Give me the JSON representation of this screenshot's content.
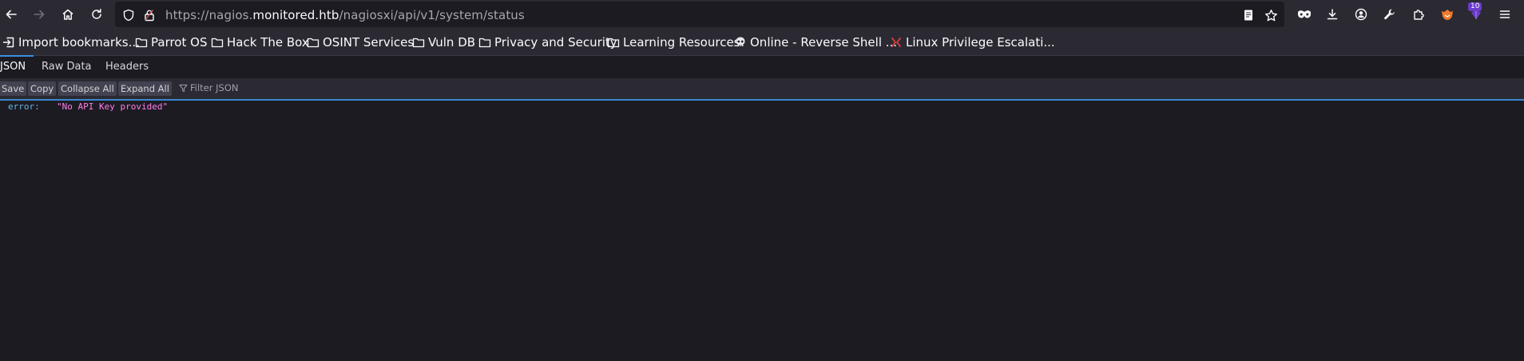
{
  "browser": {
    "url": {
      "prefix": "https://nagios.",
      "host": "monitored.htb",
      "path": "/nagiosxi/api/v1/system/status"
    },
    "extension_badge": "10"
  },
  "bookmarks": [
    {
      "label": "Import bookmarks...",
      "icon": "import-icon"
    },
    {
      "label": "Parrot OS",
      "icon": "folder-icon"
    },
    {
      "label": "Hack The Box",
      "icon": "folder-icon"
    },
    {
      "label": "OSINT Services",
      "icon": "folder-icon"
    },
    {
      "label": "Vuln DB",
      "icon": "folder-icon"
    },
    {
      "label": "Privacy and Security",
      "icon": "folder-icon"
    },
    {
      "label": "Learning Resources",
      "icon": "folder-icon"
    },
    {
      "label": "Online - Reverse Shell ...",
      "icon": "skull-icon"
    },
    {
      "label": "Linux Privilege Escalati...",
      "icon": "gtfobins-icon"
    }
  ],
  "viewer": {
    "tabs": [
      "JSON",
      "Raw Data",
      "Headers"
    ],
    "toolbar": {
      "save": "Save",
      "copy": "Copy",
      "collapse_all": "Collapse All",
      "expand_all": "Expand All",
      "filter_placeholder": "Filter JSON"
    },
    "json": [
      {
        "key": "error:",
        "value": "\"No API Key provided\""
      }
    ]
  },
  "colors": {
    "accent": "#3d8fe0",
    "json_key": "#62b8e6",
    "json_string": "#ff7de9"
  }
}
